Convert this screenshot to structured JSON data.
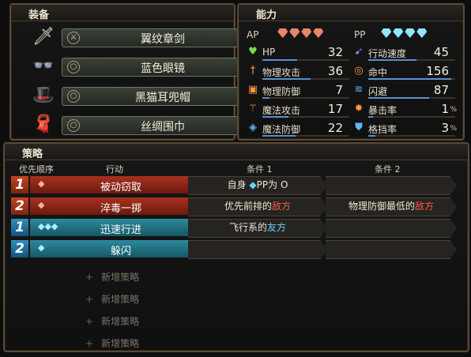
{
  "equipment": {
    "title": "装备",
    "items": [
      {
        "name": "翼纹章剑",
        "slot_icon": "sword-slot-icon",
        "icon": "sword-icon"
      },
      {
        "name": "蓝色眼镜",
        "slot_icon": "ring-slot-icon",
        "icon": "glasses-icon"
      },
      {
        "name": "黑猫耳兜帽",
        "slot_icon": "ring-slot-icon",
        "icon": "hood-icon"
      },
      {
        "name": "丝绸围巾",
        "slot_icon": "ring-slot-icon",
        "icon": "scarf-icon"
      }
    ]
  },
  "ability": {
    "title": "能力",
    "ap_label": "AP",
    "pp_label": "PP",
    "ap_gems": 4,
    "pp_gems": 4,
    "stats_left": [
      {
        "label": "HP",
        "value": "32",
        "icon": "heart-icon",
        "color": "#7ed957",
        "level": 0.4
      },
      {
        "label": "物理攻击",
        "value": "36",
        "icon": "sword-icon",
        "color": "#ff9a3c",
        "level": 0.55
      },
      {
        "label": "物理防御",
        "value": "7",
        "icon": "armor-icon",
        "color": "#ff9a3c",
        "level": 0.08
      },
      {
        "label": "魔法攻击",
        "value": "17",
        "icon": "wand-icon",
        "color": "#ff9a3c",
        "level": 0.3
      },
      {
        "label": "魔法防御",
        "value": "22",
        "icon": "magic-armor-icon",
        "color": "#5ab8ff",
        "level": 0.38
      }
    ],
    "stats_right": [
      {
        "label": "行动速度",
        "value": "45",
        "icon": "boot-icon",
        "color": "#b07cff",
        "level": 0.55,
        "pct": ""
      },
      {
        "label": "命中",
        "value": "156",
        "icon": "target-icon",
        "color": "#ff9a3c",
        "level": 0.95,
        "pct": ""
      },
      {
        "label": "闪避",
        "value": "87",
        "icon": "wind-icon",
        "color": "#5ab8ff",
        "level": 0.7,
        "pct": ""
      },
      {
        "label": "暴击率",
        "value": "1",
        "icon": "burst-icon",
        "color": "#ff9a3c",
        "level": 0.05,
        "pct": "%"
      },
      {
        "label": "格挡率",
        "value": "3",
        "icon": "shield-icon",
        "color": "#5ab8ff",
        "level": 0.08,
        "pct": "%"
      }
    ]
  },
  "strategy": {
    "title": "策略",
    "headers": {
      "priority": "优先顺序",
      "action": "行动",
      "cond1": "条件 1",
      "cond2": "条件 2"
    },
    "rows": [
      {
        "priority": "1",
        "type": "AP",
        "gems": "◆",
        "action": "被动窃取",
        "cond1": [
          {
            "t": "自身 ",
            "c": ""
          },
          {
            "t": "◆",
            "c": "blue"
          },
          {
            "t": "PP为 O",
            "c": ""
          }
        ],
        "cond2": []
      },
      {
        "priority": "2",
        "type": "AP",
        "gems": "◆",
        "action": "淬毒一掷",
        "cond1": [
          {
            "t": "优先前排的",
            "c": ""
          },
          {
            "t": "敌方",
            "c": "red"
          }
        ],
        "cond2": [
          {
            "t": "物理防御最低的",
            "c": ""
          },
          {
            "t": "敌方",
            "c": "red"
          }
        ]
      },
      {
        "priority": "1",
        "type": "PP",
        "gems": "◆◆◆",
        "action": "迅速行进",
        "cond1": [
          {
            "t": "飞行系的",
            "c": ""
          },
          {
            "t": "友方",
            "c": "blue"
          }
        ],
        "cond2": []
      },
      {
        "priority": "2",
        "type": "PP",
        "gems": "◆",
        "action": "躲闪",
        "cond1": [],
        "cond2": []
      }
    ],
    "add_label": "新增策略",
    "add_count": 4
  }
}
